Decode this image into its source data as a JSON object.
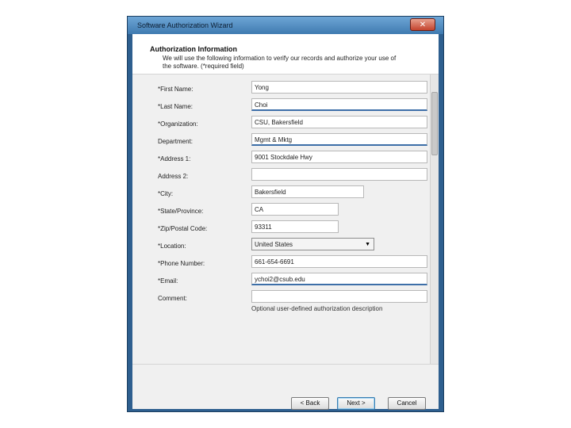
{
  "window": {
    "title": "Software Authorization Wizard",
    "close_glyph": "✕"
  },
  "header": {
    "title": "Authorization Information",
    "description": "We will use the following information to verify our records and authorize your use of the software. (*required field)"
  },
  "form": {
    "fields": [
      {
        "label": "*First Name:",
        "value": "Yong"
      },
      {
        "label": "*Last Name:",
        "value": "Choi"
      },
      {
        "label": "*Organization:",
        "value": "CSU, Bakersfield"
      },
      {
        "label": "Department:",
        "value": "Mgmt & Mktg"
      },
      {
        "label": "*Address 1:",
        "value": "9001 Stockdale Hwy"
      },
      {
        "label": "Address 2:",
        "value": ""
      },
      {
        "label": "*City:",
        "value": "Bakersfield"
      },
      {
        "label": "*State/Province:",
        "value": "CA"
      },
      {
        "label": "*Zip/Postal Code:",
        "value": "93311"
      },
      {
        "label": "*Location:",
        "value": "United States"
      },
      {
        "label": "*Phone Number:",
        "value": "661-654-6691"
      },
      {
        "label": "*Email:",
        "value": "ychoi2@csub.edu"
      },
      {
        "label": "Comment:",
        "value": ""
      }
    ],
    "comment_hint": "Optional user-defined authorization description"
  },
  "buttons": {
    "back": "< Back",
    "next": "Next >",
    "cancel": "Cancel"
  },
  "icons": {
    "close": "close-icon",
    "dropdown": "chevron-down-icon"
  },
  "colors": {
    "window_frame": "#2e5f8f",
    "close_button": "#c4442e",
    "focus_border": "#3d6fa8"
  }
}
